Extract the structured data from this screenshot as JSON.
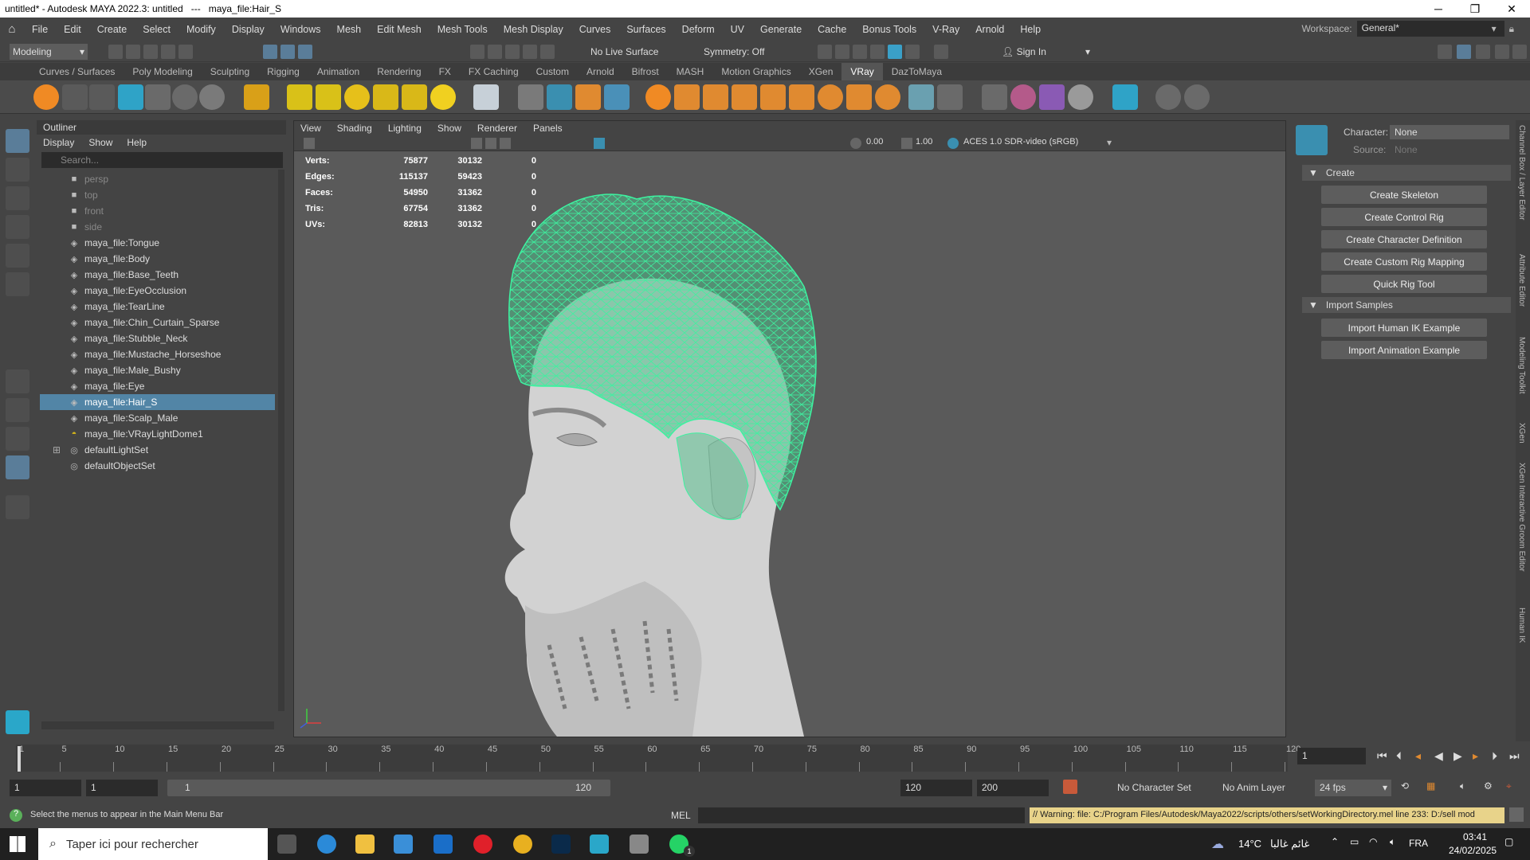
{
  "window": {
    "title": "untitled* - Autodesk MAYA 2022.3: untitled   ---   maya_file:Hair_S",
    "minimize": "─",
    "maximize": "❐",
    "close": "✕"
  },
  "menubar": {
    "items": [
      "File",
      "Edit",
      "Create",
      "Select",
      "Modify",
      "Display",
      "Windows",
      "Mesh",
      "Edit Mesh",
      "Mesh Tools",
      "Mesh Display",
      "Curves",
      "Surfaces",
      "Deform",
      "UV",
      "Generate",
      "Cache",
      "Bonus Tools",
      "V-Ray",
      "Arnold",
      "Help"
    ],
    "workspace_label": "Workspace:",
    "workspace_value": "General*"
  },
  "statusline": {
    "mode": "Modeling",
    "live_surface": "No Live Surface",
    "symmetry": "Symmetry: Off",
    "sign_in": "Sign In"
  },
  "shelf_tabs": {
    "items": [
      "Curves / Surfaces",
      "Poly Modeling",
      "Sculpting",
      "Rigging",
      "Animation",
      "Rendering",
      "FX",
      "FX Caching",
      "Custom",
      "Arnold",
      "Bifrost",
      "MASH",
      "Motion Graphics",
      "XGen",
      "VRay",
      "DazToMaya"
    ],
    "active": "VRay"
  },
  "outliner": {
    "title": "Outliner",
    "menu": [
      "Display",
      "Show",
      "Help"
    ],
    "search_placeholder": "Search...",
    "items": [
      {
        "label": "persp",
        "dim": true,
        "icon": "camera-icon"
      },
      {
        "label": "top",
        "dim": true,
        "icon": "camera-icon"
      },
      {
        "label": "front",
        "dim": true,
        "icon": "camera-icon"
      },
      {
        "label": "side",
        "dim": true,
        "icon": "camera-icon"
      },
      {
        "label": "maya_file:Tongue",
        "icon": "mesh-icon"
      },
      {
        "label": "maya_file:Body",
        "icon": "mesh-icon"
      },
      {
        "label": "maya_file:Base_Teeth",
        "icon": "mesh-icon"
      },
      {
        "label": "maya_file:EyeOcclusion",
        "icon": "mesh-icon"
      },
      {
        "label": "maya_file:TearLine",
        "icon": "mesh-icon"
      },
      {
        "label": "maya_file:Chin_Curtain_Sparse",
        "icon": "mesh-icon"
      },
      {
        "label": "maya_file:Stubble_Neck",
        "icon": "mesh-icon"
      },
      {
        "label": "maya_file:Mustache_Horseshoe",
        "icon": "mesh-icon"
      },
      {
        "label": "maya_file:Male_Bushy",
        "icon": "mesh-icon"
      },
      {
        "label": "maya_file:Eye",
        "icon": "mesh-icon"
      },
      {
        "label": "maya_file:Hair_S",
        "icon": "mesh-icon",
        "selected": true
      },
      {
        "label": "maya_file:Scalp_Male",
        "icon": "mesh-icon"
      },
      {
        "label": "maya_file:VRayLightDome1",
        "icon": "dome-light-icon"
      },
      {
        "label": "defaultLightSet",
        "icon": "set-icon",
        "expand": true
      },
      {
        "label": "defaultObjectSet",
        "icon": "set-icon"
      }
    ]
  },
  "viewport": {
    "menu": [
      "View",
      "Shading",
      "Lighting",
      "Show",
      "Renderer",
      "Panels"
    ],
    "exposure": "0.00",
    "gamma": "1.00",
    "color_space": "ACES 1.0 SDR-video (sRGB)",
    "hud": [
      {
        "label": "Verts:",
        "a": "75877",
        "b": "30132",
        "c": "0"
      },
      {
        "label": "Edges:",
        "a": "115137",
        "b": "59423",
        "c": "0"
      },
      {
        "label": "Faces:",
        "a": "54950",
        "b": "31362",
        "c": "0"
      },
      {
        "label": "Tris:",
        "a": "67754",
        "b": "31362",
        "c": "0"
      },
      {
        "label": "UVs:",
        "a": "82813",
        "b": "30132",
        "c": "0"
      }
    ],
    "wire_color": "#3df2a0"
  },
  "hik": {
    "character_label": "Character:",
    "character_value": "None",
    "source_label": "Source:",
    "source_value": "None",
    "create_section": "Create",
    "create_buttons": [
      "Create Skeleton",
      "Create Control Rig",
      "Create Character Definition",
      "Create Custom Rig Mapping",
      "Quick Rig Tool"
    ],
    "import_section": "Import Samples",
    "import_buttons": [
      "Import Human IK Example",
      "Import Animation Example"
    ]
  },
  "side_tabs": [
    "Channel Box / Layer Editor",
    "Attribute Editor",
    "Modeling Toolkit",
    "XGen",
    "XGen Interactive Groom Editor",
    "Human IK"
  ],
  "timeline": {
    "ticks": [
      "1",
      "5",
      "10",
      "15",
      "20",
      "25",
      "30",
      "35",
      "40",
      "45",
      "50",
      "55",
      "60",
      "65",
      "70",
      "75",
      "80",
      "85",
      "90",
      "95",
      "100",
      "105",
      "110",
      "115",
      "120"
    ],
    "current_frame": "1"
  },
  "range": {
    "start": "1",
    "playback_start": "1",
    "slider_start": "1",
    "slider_end": "120",
    "playback_end": "120",
    "end": "200",
    "character_set": "No Character Set",
    "anim_layer": "No Anim Layer",
    "fps": "24 fps"
  },
  "command": {
    "help_text": "Select the menus to appear in the Main Menu Bar",
    "mel_label": "MEL",
    "warning": "// Warning: file: C:/Program Files/Autodesk/Maya2022/scripts/others/setWorkingDirectory.mel line 233: D:/sell mod"
  },
  "taskbar": {
    "search_placeholder": "Taper ici pour rechercher",
    "weather": "14°C",
    "weather_text": "غائم غالبا",
    "language": "FRA",
    "time": "03:41",
    "date": "24/02/2025",
    "whatsapp_badge": "1"
  }
}
